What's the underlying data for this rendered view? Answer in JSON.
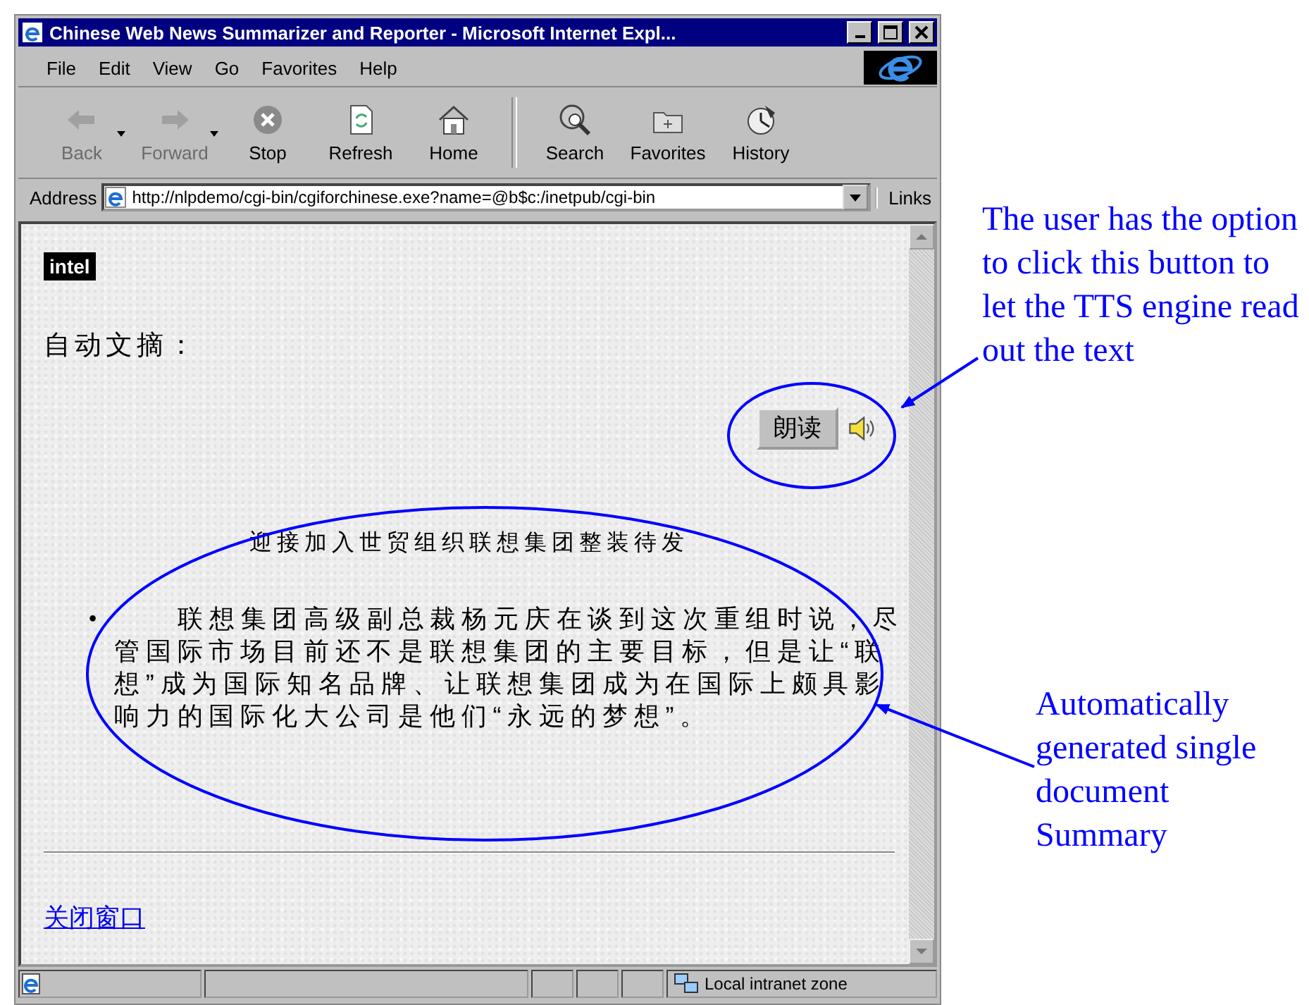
{
  "window": {
    "title": "Chinese Web News Summarizer and Reporter - Microsoft Internet Expl..."
  },
  "menu": [
    "File",
    "Edit",
    "View",
    "Go",
    "Favorites",
    "Help"
  ],
  "toolbar": [
    {
      "kind": "back",
      "label": "Back",
      "disabled": true,
      "dropdown": true
    },
    {
      "kind": "forward",
      "label": "Forward",
      "disabled": true,
      "dropdown": true
    },
    {
      "kind": "stop",
      "label": "Stop",
      "disabled": false,
      "dropdown": false
    },
    {
      "kind": "refresh",
      "label": "Refresh",
      "disabled": false,
      "dropdown": false
    },
    {
      "kind": "home",
      "label": "Home",
      "disabled": false,
      "dropdown": false
    },
    {
      "kind": "search",
      "label": "Search",
      "disabled": false,
      "dropdown": false
    },
    {
      "kind": "favorites",
      "label": "Favorites",
      "disabled": false,
      "dropdown": false
    },
    {
      "kind": "history",
      "label": "History",
      "disabled": false,
      "dropdown": false
    }
  ],
  "address_bar": {
    "label": "Address",
    "value": "http://nlpdemo/cgi-bin/cgiforchinese.exe?name=@b$c:/inetpub/cgi-bin",
    "links": "Links"
  },
  "page": {
    "logo": "intel",
    "heading": "自动文摘：",
    "read_button": "朗读",
    "title": "迎接加入世贸组织联想集团整装待发",
    "summary": [
      {
        "bullet": "•",
        "text": "联想集团高级副总裁杨元庆在谈到这次重组时说，尽管国际市场目前还不是联想集团的主要目标，但是让“联想”成为国际知名品牌、让联想集团成为在国际上颇具影响力的国际化大公司是他们“永远的梦想”。"
      }
    ],
    "link": "关闭窗口"
  },
  "status_bar": {
    "zone": "Local intranet zone"
  },
  "annotations": [
    {
      "text": "The user has the option to click this button to let the TTS engine read out the text"
    },
    {
      "text": "Automatically generated single document Summary"
    }
  ]
}
